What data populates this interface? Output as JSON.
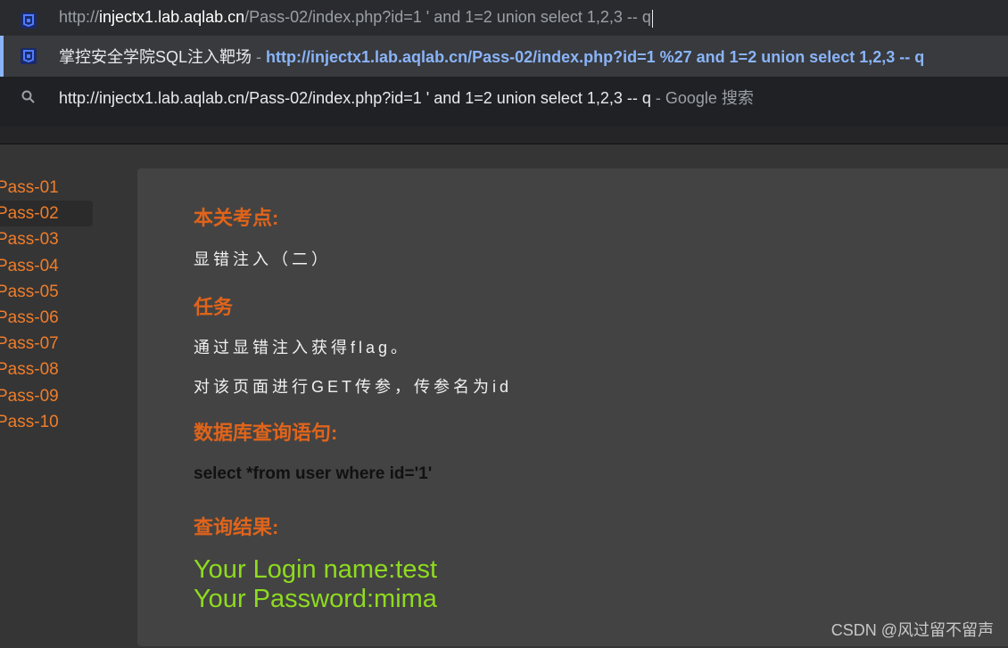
{
  "omnibox": {
    "address": {
      "prefix": "http://",
      "host": "injectx1.lab.aqlab.cn",
      "rest": "/Pass-02/index.php?id=1 ' and 1=2 union select 1,2,3 -- q"
    },
    "suggestions": [
      {
        "title": "掌控安全学院SQL注入靶场",
        "separator": " - ",
        "url": "http://injectx1.lab.aqlab.cn/Pass-02/index.php?id=1 %27 and 1=2 union select 1,2,3 -- q"
      },
      {
        "query": "http://injectx1.lab.aqlab.cn/Pass-02/index.php?id=1 ' and 1=2 union select 1,2,3 -- q",
        "suffix": " - Google 搜索"
      }
    ]
  },
  "sidebar": {
    "items": [
      "Pass-01",
      "Pass-02",
      "Pass-03",
      "Pass-04",
      "Pass-05",
      "Pass-06",
      "Pass-07",
      "Pass-08",
      "Pass-09",
      "Pass-10"
    ],
    "active_index": 1
  },
  "main": {
    "heading_points": "本关考点:",
    "points_text": "显错注入（二）",
    "heading_task": "任务",
    "task_line1": "通过显错注入获得flag。",
    "task_line2": "对该页面进行GET传参，传参名为id",
    "heading_query": "数据库查询语句:",
    "query_text": "select *from user where id='1'",
    "heading_result": "查询结果:",
    "result_line1": "Your Login name:test",
    "result_line2": "Your Password:mima"
  },
  "watermark": "CSDN @风过留不留声",
  "colors": {
    "accent_orange": "#e0641b",
    "link_blue": "#8ab4f8",
    "result_green": "#8edb1f"
  }
}
